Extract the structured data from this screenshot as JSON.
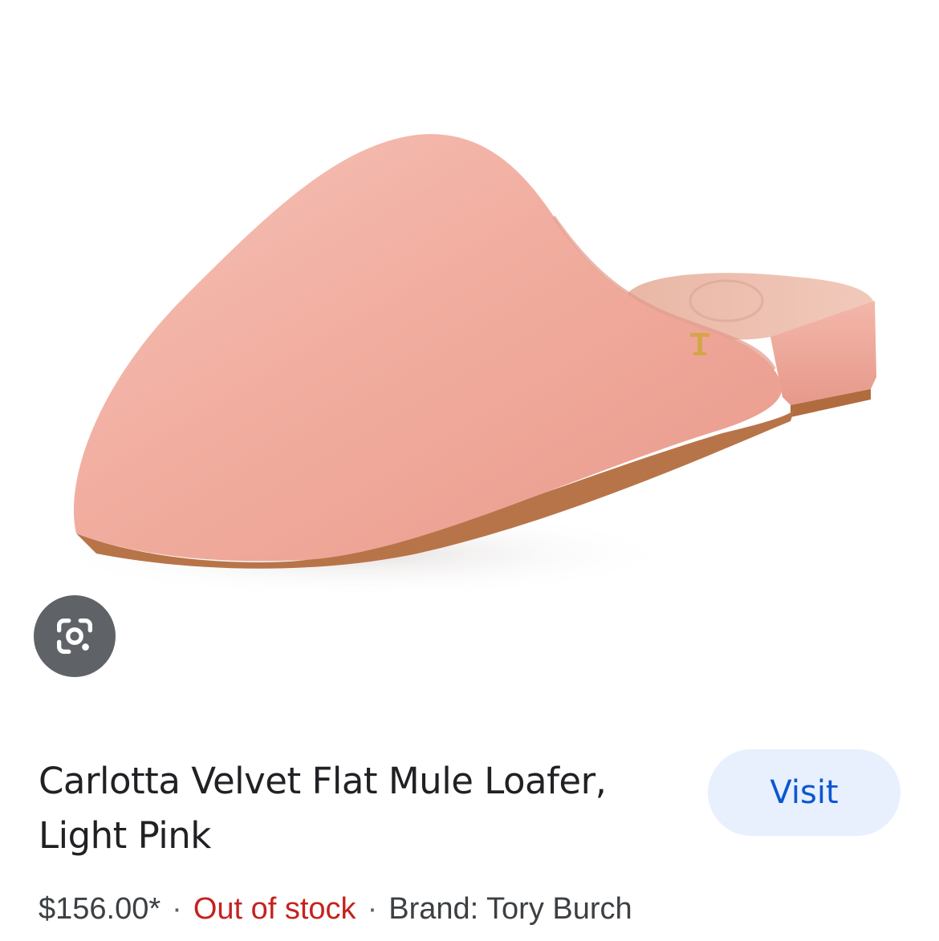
{
  "product": {
    "title": "Carlotta Velvet Flat Mule Loafer, Light Pink",
    "price": "$156.00*",
    "stock_status": "Out of stock",
    "brand_text": "Brand: Tory Burch",
    "separator": "·",
    "image_alt": "Carlotta Velvet Flat Mule Loafer, Light Pink"
  },
  "actions": {
    "visit_label": "Visit",
    "lens_icon": "google-lens-icon"
  },
  "colors": {
    "stock_red": "#c5221f",
    "visit_bg": "#e8f0fe",
    "visit_text": "#0b57d0",
    "lens_bg": "#5f6368",
    "shoe_pink": "#f2b3a8"
  }
}
